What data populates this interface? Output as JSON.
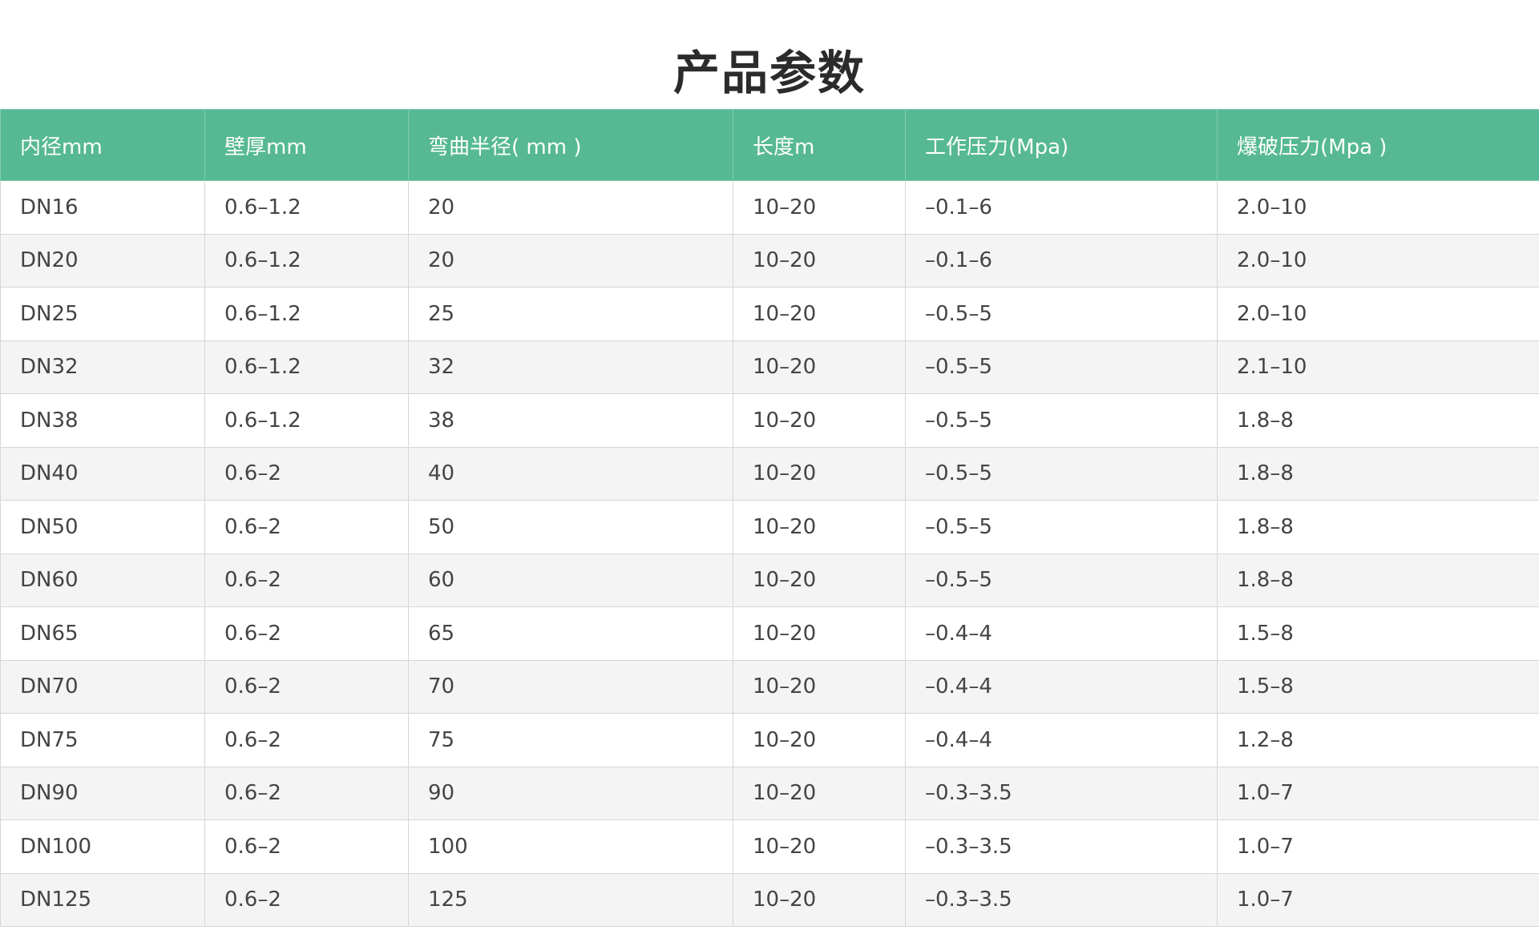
{
  "title": "产品参数",
  "colors": {
    "header_bg": "#56b993",
    "header_text": "#ffffff",
    "row_alt_bg": "#f4f4f4",
    "border": "#d6d6d6"
  },
  "table": {
    "headers": [
      "内径mm",
      "壁厚mm",
      "弯曲半径( mm )",
      "长度m",
      "工作压力(Mpa)",
      "爆破压力(Mpa )"
    ],
    "rows": [
      [
        "DN16",
        "0.6–1.2",
        "20",
        "10–20",
        "–0.1–6",
        "2.0–10"
      ],
      [
        "DN20",
        "0.6–1.2",
        "20",
        "10–20",
        "–0.1–6",
        "2.0–10"
      ],
      [
        "DN25",
        "0.6–1.2",
        "25",
        "10–20",
        "–0.5–5",
        "2.0–10"
      ],
      [
        "DN32",
        "0.6–1.2",
        "32",
        "10–20",
        "–0.5–5",
        "2.1–10"
      ],
      [
        "DN38",
        "0.6–1.2",
        "38",
        "10–20",
        "–0.5–5",
        "1.8–8"
      ],
      [
        "DN40",
        "0.6–2",
        "40",
        "10–20",
        "–0.5–5",
        "1.8–8"
      ],
      [
        "DN50",
        "0.6–2",
        "50",
        "10–20",
        "–0.5–5",
        "1.8–8"
      ],
      [
        "DN60",
        "0.6–2",
        "60",
        "10–20",
        "–0.5–5",
        "1.8–8"
      ],
      [
        "DN65",
        "0.6–2",
        "65",
        "10–20",
        "–0.4–4",
        "1.5–8"
      ],
      [
        "DN70",
        "0.6–2",
        "70",
        "10–20",
        "–0.4–4",
        "1.5–8"
      ],
      [
        "DN75",
        "0.6–2",
        "75",
        "10–20",
        "–0.4–4",
        "1.2–8"
      ],
      [
        "DN90",
        "0.6–2",
        "90",
        "10–20",
        "–0.3–3.5",
        "1.0–7"
      ],
      [
        "DN100",
        "0.6–2",
        "100",
        "10–20",
        "–0.3–3.5",
        "1.0–7"
      ],
      [
        "DN125",
        "0.6–2",
        "125",
        "10–20",
        "–0.3–3.5",
        "1.0–7"
      ]
    ]
  }
}
